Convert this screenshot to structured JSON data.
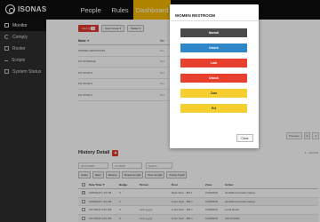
{
  "brand": {
    "name": "ISONAS",
    "sub": "Pure Access"
  },
  "nav": {
    "people": "People",
    "rules": "Rules",
    "dashboard": "Dashboard"
  },
  "sidebar": {
    "items": [
      {
        "label": "Monitor",
        "icon": "monitor-icon"
      },
      {
        "label": "Comply",
        "icon": "comply-icon"
      },
      {
        "label": "Roster",
        "icon": "roster-icon"
      },
      {
        "label": "Scripts",
        "icon": "scripts-icon"
      },
      {
        "label": "System Status",
        "icon": "system-status-icon"
      }
    ]
  },
  "toolbar": {
    "alarms_label": "Alarms",
    "alarms_count": "11",
    "door_group": "Door Group ▾",
    "status": "Status ▾"
  },
  "doors": {
    "header_name": "Name ▼",
    "header_mode": "Mo",
    "rows": [
      {
        "name": "WOMEN RESTROOM",
        "mode": "Nor"
      },
      {
        "name": "PH STORAGE",
        "mode": "Nor"
      },
      {
        "name": "PH STAIR 3",
        "mode": "Nor"
      },
      {
        "name": "PH STAIR 2",
        "mode": "Nor"
      },
      {
        "name": "PH STAIR 1",
        "mode": "Nor"
      }
    ]
  },
  "pager": {
    "previous": "Previous",
    "p1": "1",
    "p2": "2"
  },
  "history": {
    "title": "History Detail",
    "count": "1 - 10 of 10",
    "date_from": "02.03.2018",
    "date_to": "3.1.2018",
    "search_placeholder": "Search...",
    "buttons": [
      "Aware",
      "Silent",
      "Restore",
      "People Group▾",
      "Door Group▾",
      "Activity Type▾"
    ],
    "columns": [
      "Date Time ▼",
      "Badge",
      "Person",
      "Door",
      "Zone",
      "Action"
    ],
    "rows": [
      {
        "checked": true,
        "date": "2/28/2018 7:16 AM",
        "badge": "0",
        "person": "",
        "door": "Back Door - Bld 1",
        "zone": "COMMON",
        "action": "ALARM-Controller Failure"
      },
      {
        "checked": false,
        "date": "2/28/2018 7:16 AM",
        "badge": "0",
        "person": "",
        "door": "Front Door - Bld 1",
        "zone": "COMMON",
        "action": "ALARM-Controller Failure"
      },
      {
        "checked": false,
        "date": "2/27/2018 4:40 PM",
        "badge": "0",
        "person": "xxxx yyyyy",
        "door": "Front Door - Bld 1",
        "zone": "COMMON",
        "action": "Local Reset"
      },
      {
        "checked": false,
        "date": "2/27/2018 4:40 PM",
        "badge": "0",
        "person": "xxxx yyyyy",
        "door": "Front Door - Bld 1",
        "zone": "COMMON",
        "action": "UNLOCKED"
      }
    ]
  },
  "modal": {
    "title": "WOMEN RESTROOM",
    "buttons": [
      {
        "label": "Normal",
        "bg": "#4a4a4a",
        "fg": "#ffffff"
      },
      {
        "label": "Unlock",
        "bg": "#2f86c9",
        "fg": "#ffffff"
      },
      {
        "label": "Lock",
        "bg": "#e8402f",
        "fg": "#ffffff"
      },
      {
        "label": "Unlock",
        "bg": "#e8402f",
        "fg": "#ffffff"
      },
      {
        "label": "Case",
        "bg": "#f4cf2f",
        "fg": "#333333"
      },
      {
        "label": "Ext",
        "bg": "#f4cf2f",
        "fg": "#333333"
      }
    ],
    "close_label": "Close"
  },
  "colors": {
    "accent": "#f5b800",
    "alarm": "#e23b2e"
  }
}
